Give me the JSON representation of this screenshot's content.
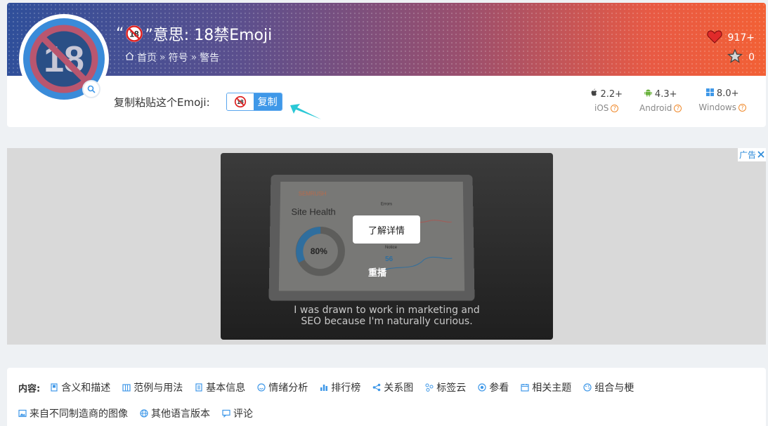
{
  "header": {
    "title_prefix": "“",
    "title_suffix": "”意思: 18禁Emoji",
    "breadcrumbs": [
      "首页",
      "符号",
      "警告"
    ],
    "breadcrumb_sep": "»",
    "likes": "917+",
    "stars": "0"
  },
  "copy": {
    "label": "复制粘贴这个Emoji:",
    "button": "复制"
  },
  "platforms": [
    {
      "icon": "apple-icon",
      "version": "2.2+",
      "name": "iOS"
    },
    {
      "icon": "android-icon",
      "version": "4.3+",
      "name": "Android"
    },
    {
      "icon": "windows-icon",
      "version": "8.0+",
      "name": "Windows"
    }
  ],
  "ad": {
    "badge": "广告",
    "learn_more": "了解详情",
    "replay": "重播",
    "caption_line1": "I was drawn to work in marketing and",
    "caption_line2": "SEO because I'm naturally curious.",
    "screen_brand": "SEMRUSH",
    "screen_title": "Site Health",
    "screen_percent": "80%",
    "screen_errors": "Errors",
    "screen_notice": "Notice",
    "screen_notice_val": "56"
  },
  "nav": {
    "label": "内容:",
    "row1": [
      "含义和描述",
      "范例与用法",
      "基本信息",
      "情绪分析",
      "排行榜",
      "关系图",
      "标签云",
      "参看",
      "相关主题",
      "组合与梗"
    ],
    "row2": [
      "来自不同制造商的图像",
      "其他语言版本",
      "评论"
    ]
  },
  "colors": {
    "accent": "#3f98e8",
    "banner_start": "#2f4f9a",
    "banner_end": "#f26035",
    "heart": "#e02a2a"
  }
}
